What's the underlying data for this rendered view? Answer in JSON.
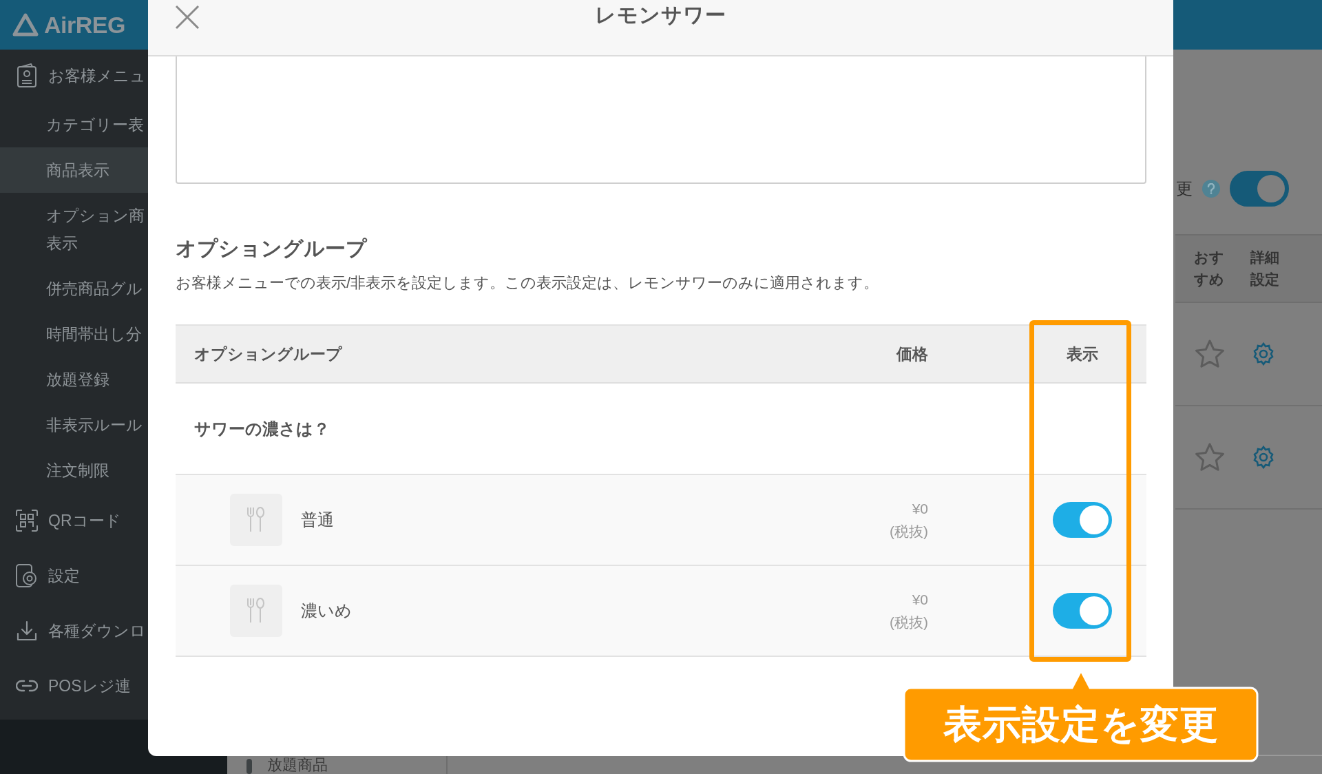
{
  "sidebar": {
    "logo": "AirREG",
    "items": [
      {
        "label": "お客様メニュ",
        "selected": false,
        "children": [
          {
            "label": "カテゴリー表",
            "selected": false
          },
          {
            "label": "商品表示",
            "selected": true
          },
          {
            "label": "オプション商表示",
            "selected": false
          },
          {
            "label": "併売商品グル",
            "selected": false
          },
          {
            "label": "時間帯出し分",
            "selected": false
          },
          {
            "label": "放題登録",
            "selected": false
          },
          {
            "label": "非表示ルール",
            "selected": false
          },
          {
            "label": "注文制限",
            "selected": false
          }
        ]
      },
      {
        "label": "QRコード",
        "selected": false
      },
      {
        "label": "設定",
        "selected": false
      },
      {
        "label": "各種ダウンロ",
        "selected": false
      },
      {
        "label": "POSレジ連",
        "selected": false
      }
    ]
  },
  "background": {
    "setting": {
      "label": "更",
      "on": true
    },
    "columns": [
      "おすすめ",
      "詳細設定"
    ],
    "rows": [
      {
        "recommended": false
      },
      {
        "recommended": false
      }
    ],
    "bottom_tab": "放題商品"
  },
  "modal": {
    "title": "レモンサワー",
    "section_title": "オプショングループ",
    "description": "お客様メニューでの表示/非表示を設定します。この表示設定は、レモンサワーのみに適用されます。",
    "columns": [
      "オプショングループ",
      "価格",
      "表示"
    ],
    "groups": [
      {
        "name": "サワーの濃さは？",
        "options": [
          {
            "name": "普通",
            "price": "¥0",
            "tax_note": "(税抜)",
            "visible": true
          },
          {
            "name": "濃いめ",
            "price": "¥0",
            "tax_note": "(税抜)",
            "visible": true
          }
        ]
      }
    ]
  },
  "annotation": {
    "text": "表示設定を変更"
  }
}
